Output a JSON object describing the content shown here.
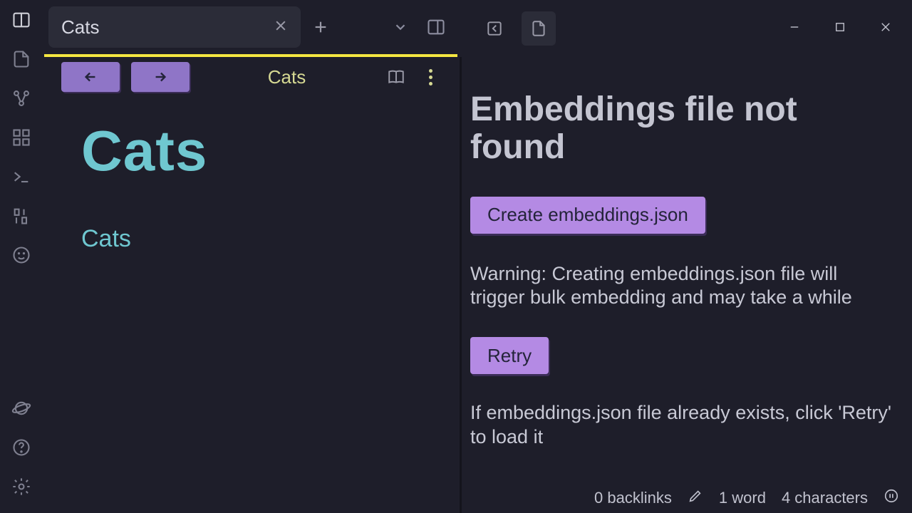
{
  "tab": {
    "title": "Cats"
  },
  "breadcrumb": "Cats",
  "document": {
    "heading": "Cats",
    "body": "Cats"
  },
  "panel": {
    "title": "Embeddings file not found",
    "create_button": "Create embeddings.json",
    "warning": "Warning: Creating embeddings.json file will trigger bulk embedding and may take a while",
    "retry_button": "Retry",
    "hint": "If embeddings.json file already exists, click 'Retry' to load it"
  },
  "status": {
    "backlinks": "0 backlinks",
    "words": "1 word",
    "chars": "4 characters"
  }
}
